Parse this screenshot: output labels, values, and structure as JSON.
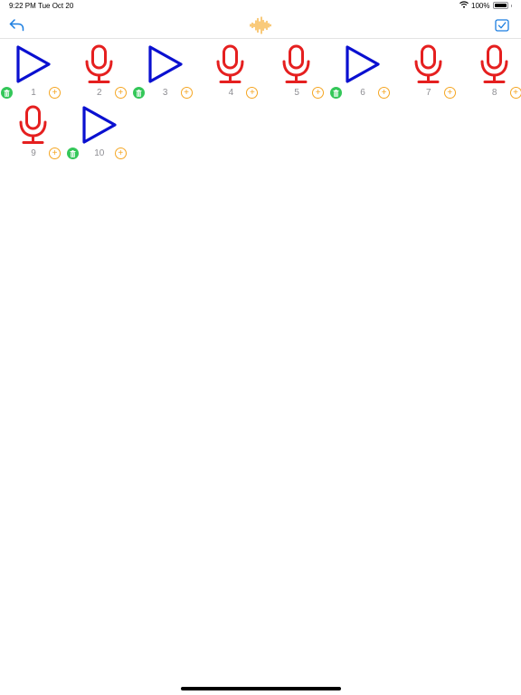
{
  "status_bar": {
    "time": "9:22 PM",
    "date": "Tue Oct 20",
    "battery": "100%",
    "battery_level": 1.0
  },
  "nav": {
    "back_icon": "undo-arrow-icon",
    "logo_icon": "waveform-icon",
    "check_icon": "checkbox-icon"
  },
  "colors": {
    "accent": "#1a7de0",
    "play": "#0a10d0",
    "mic": "#e51f1f",
    "delete": "#34c759",
    "add": "#f5a623",
    "number": "#8e8e93"
  },
  "tracks": [
    {
      "number": "1",
      "state": "play",
      "has_delete": true
    },
    {
      "number": "2",
      "state": "mic",
      "has_delete": false
    },
    {
      "number": "3",
      "state": "play",
      "has_delete": true
    },
    {
      "number": "4",
      "state": "mic",
      "has_delete": false
    },
    {
      "number": "5",
      "state": "mic",
      "has_delete": false
    },
    {
      "number": "6",
      "state": "play",
      "has_delete": true
    },
    {
      "number": "7",
      "state": "mic",
      "has_delete": false
    },
    {
      "number": "8",
      "state": "mic",
      "has_delete": false
    },
    {
      "number": "9",
      "state": "mic",
      "has_delete": false
    },
    {
      "number": "10",
      "state": "play",
      "has_delete": true
    }
  ],
  "add_label": "+"
}
